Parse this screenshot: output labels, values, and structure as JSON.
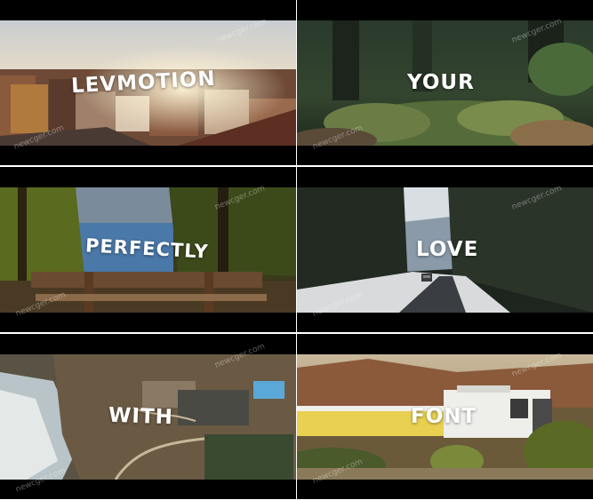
{
  "captions": [
    "LEVMOTION",
    "YOUR",
    "PERFECTLY",
    "LOVE",
    "WITH",
    "FONT"
  ],
  "watermark": "newcger.com"
}
